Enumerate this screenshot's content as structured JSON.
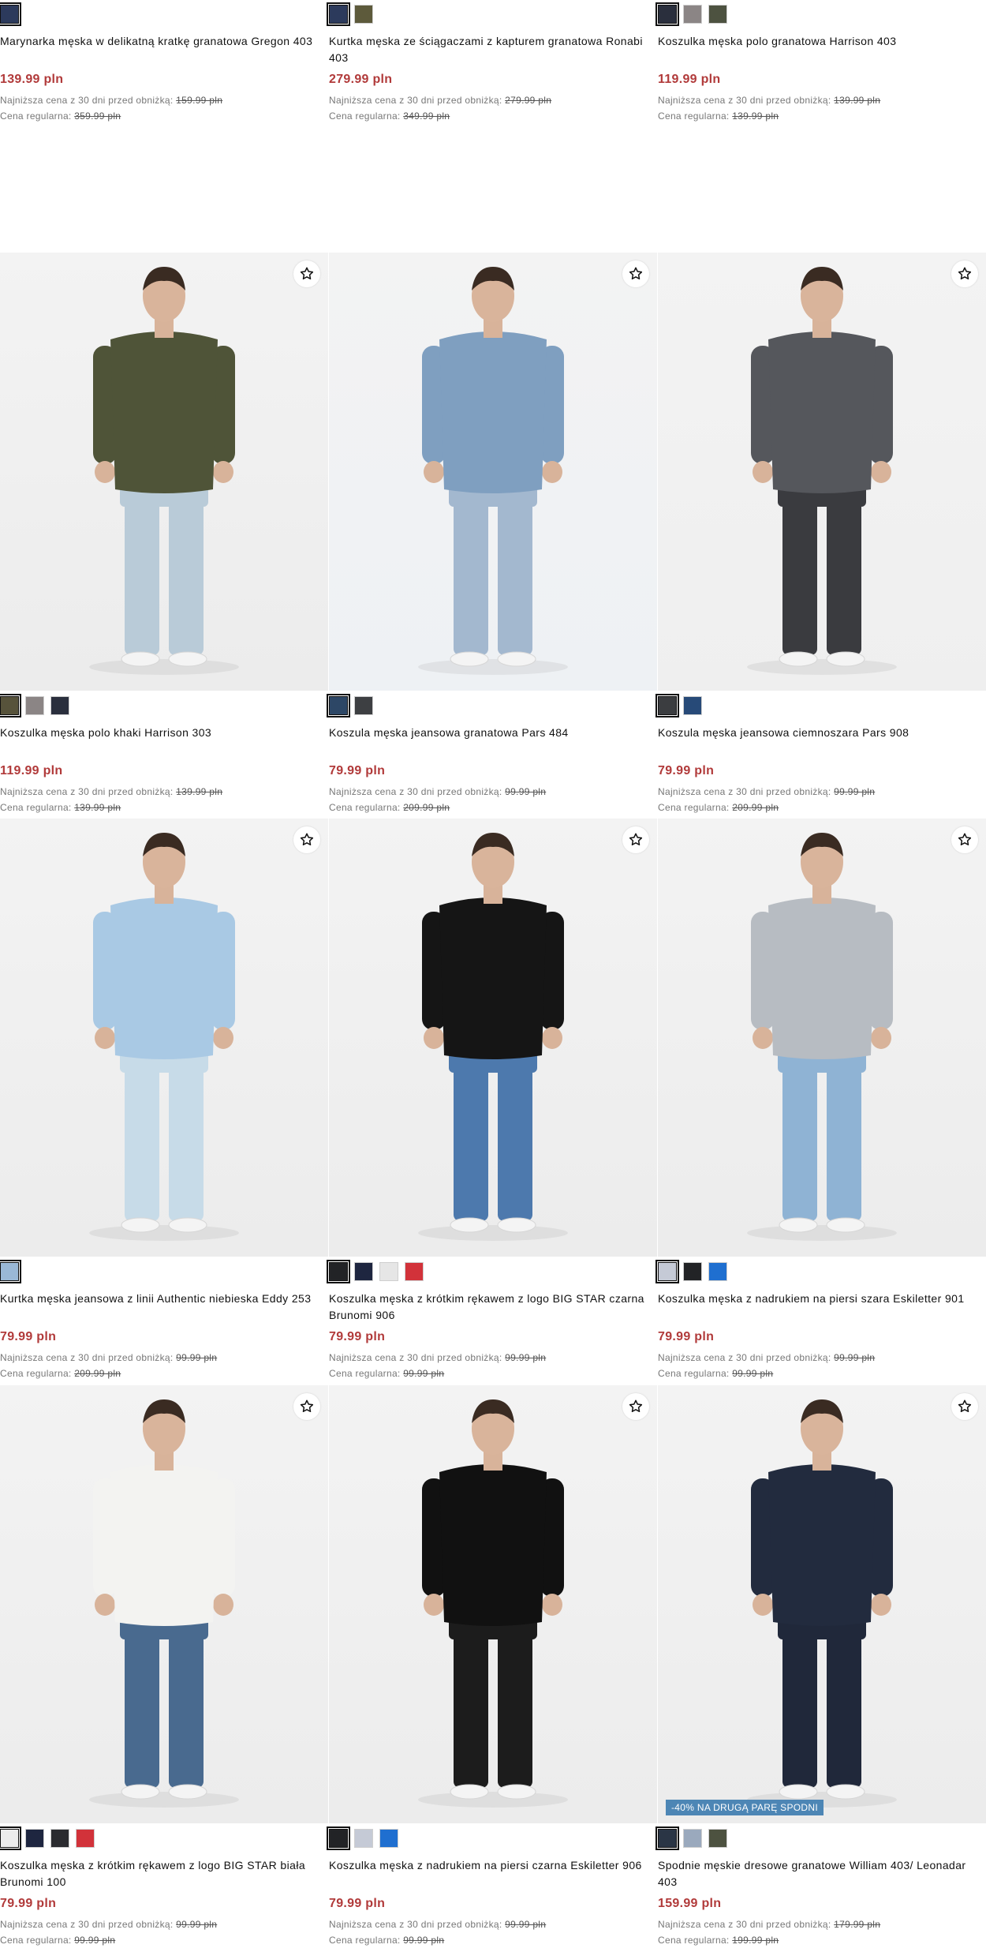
{
  "strings": {
    "lowest_label": "Najniższa cena z 30 dni przed obniżką:",
    "regular_label": "Cena regularna:"
  },
  "products": [
    {
      "name": "Marynarka męska w delikatną kratkę granatowa Gregon 403",
      "price": "139.99 pln",
      "lowest": "159.99 pln",
      "regular": "359.99 pln",
      "swatches": [
        "#2c3a5c"
      ],
      "has_photo": false
    },
    {
      "name": "Kurtka męska ze ściągaczami z kapturem granatowa Ronabi 403",
      "price": "279.99 pln",
      "lowest": "279.99 pln",
      "regular": "349.99 pln",
      "swatches": [
        "#2c3a5c",
        "#5d5a3b"
      ],
      "has_photo": false
    },
    {
      "name": "Koszulka męska polo granatowa Harrison 403",
      "price": "119.99 pln",
      "lowest": "139.99 pln",
      "regular": "139.99 pln",
      "swatches": [
        "#2a2f3d",
        "#8b8585",
        "#4d5240"
      ],
      "has_photo": false
    },
    {
      "name": "Koszulka męska polo khaki Harrison 303",
      "price": "119.99 pln",
      "lowest": "139.99 pln",
      "regular": "139.99 pln",
      "swatches": [
        "#57533b",
        "#8b8585",
        "#2a2f3d"
      ],
      "has_photo": true,
      "shirt": "#4f5438",
      "pants": "#b9cbd8",
      "bg": "#ececec"
    },
    {
      "name": "Koszula męska jeansowa granatowa Pars 484",
      "price": "79.99 pln",
      "lowest": "99.99 pln",
      "regular": "209.99 pln",
      "swatches": [
        "#2d4766",
        "#3d3f42"
      ],
      "has_photo": true,
      "shirt": "#7f9fc0",
      "pants": "#a3b8cf",
      "bg": "#eef1f4"
    },
    {
      "name": "Koszula męska jeansowa ciemnoszara Pars 908",
      "price": "79.99 pln",
      "lowest": "99.99 pln",
      "regular": "209.99 pln",
      "swatches": [
        "#3b3d40",
        "#274a78"
      ],
      "has_photo": true,
      "shirt": "#55575c",
      "pants": "#3a3b3f",
      "bg": "#efefef"
    },
    {
      "name": "Kurtka męska jeansowa z linii Authentic niebieska Eddy 253",
      "price": "79.99 pln",
      "lowest": "99.99 pln",
      "regular": "209.99 pln",
      "swatches": [
        "#9ab8d6"
      ],
      "has_photo": true,
      "shirt": "#a9c9e4",
      "pants": "#c7dbe8",
      "bg": "#ececec"
    },
    {
      "name": "Koszulka męska z krótkim rękawem z logo BIG STAR czarna Brunomi 906",
      "price": "79.99 pln",
      "lowest": "99.99 pln",
      "regular": "99.99 pln",
      "swatches": [
        "#222326",
        "#1e2640",
        "#e6e6e6",
        "#d2323a"
      ],
      "has_photo": true,
      "shirt": "#151515",
      "pants": "#4d79ad",
      "bg": "#ececec"
    },
    {
      "name": "Koszulka męska z nadrukiem na piersi szara Eskiletter 901",
      "price": "79.99 pln",
      "lowest": "99.99 pln",
      "regular": "99.99 pln",
      "swatches": [
        "#c5cad6",
        "#222326",
        "#1f6fd0"
      ],
      "has_photo": true,
      "shirt": "#b7bcc2",
      "pants": "#8fb3d4",
      "bg": "#ececec"
    },
    {
      "name": "Koszulka męska z krótkim rękawem z logo BIG STAR biała Brunomi 100",
      "price": "79.99 pln",
      "lowest": "99.99 pln",
      "regular": "99.99 pln",
      "swatches": [
        "#ececec",
        "#1e2640",
        "#2a2b2f",
        "#d2323a"
      ],
      "has_photo": true,
      "shirt": "#f3f3f1",
      "pants": "#496a8f",
      "bg": "#ececec"
    },
    {
      "name": "Koszulka męska z nadrukiem na piersi czarna Eskiletter 906",
      "price": "79.99 pln",
      "lowest": "99.99 pln",
      "regular": "99.99 pln",
      "swatches": [
        "#222326",
        "#c5cad6",
        "#1f6fd0"
      ],
      "has_photo": true,
      "shirt": "#111111",
      "pants": "#1c1c1c",
      "bg": "#ececec"
    },
    {
      "name": "Spodnie męskie dresowe granatowe William 403/ Leonadar 403",
      "price": "159.99 pln",
      "lowest": "179.99 pln",
      "regular": "199.99 pln",
      "swatches": [
        "#2a3545",
        "#9aa9bd",
        "#4d5240"
      ],
      "has_photo": true,
      "shirt": "#222b3e",
      "pants": "#20283a",
      "bg": "#ececec",
      "promo": "-40% NA DRUGĄ PARĘ SPODNI"
    }
  ]
}
